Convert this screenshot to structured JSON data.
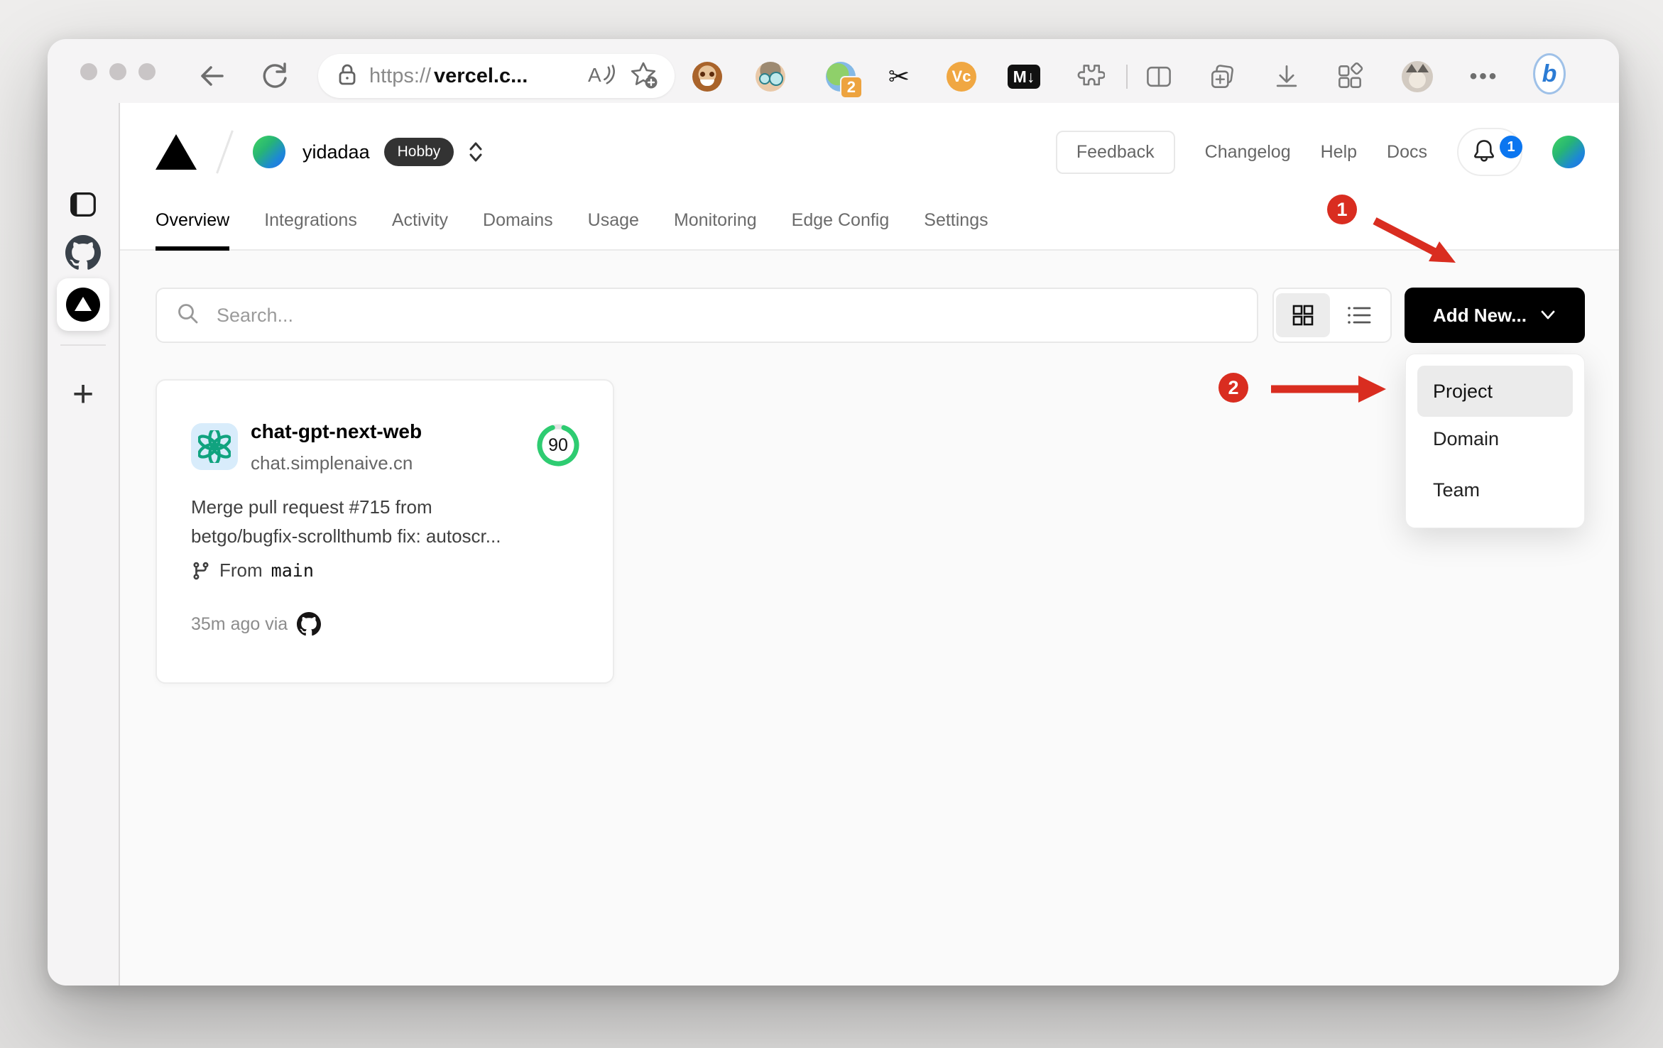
{
  "browser": {
    "address": {
      "scheme": "https://",
      "host": "vercel.c..."
    },
    "extensions": {
      "badge_count": "2",
      "vc_label": "Vc",
      "markdown_label": "M↓",
      "scissors_glyph": "✂"
    },
    "more_label": "•••",
    "bing_label": "b"
  },
  "edge_sidebar": {
    "new_tab_label": "+"
  },
  "vercel": {
    "header": {
      "team_name": "yidadaa",
      "plan_badge": "Hobby",
      "feedback_label": "Feedback",
      "links": {
        "changelog": "Changelog",
        "help": "Help",
        "docs": "Docs"
      },
      "notification_count": "1"
    },
    "tabs": [
      {
        "label": "Overview",
        "active": true
      },
      {
        "label": "Integrations"
      },
      {
        "label": "Activity"
      },
      {
        "label": "Domains"
      },
      {
        "label": "Usage"
      },
      {
        "label": "Monitoring"
      },
      {
        "label": "Edge Config"
      },
      {
        "label": "Settings"
      }
    ],
    "toolbar": {
      "search_placeholder": "Search...",
      "add_new_label": "Add New..."
    },
    "add_new_menu": {
      "items": [
        {
          "label": "Project",
          "highlighted": true
        },
        {
          "label": "Domain"
        },
        {
          "label": "Team"
        }
      ]
    },
    "project_card": {
      "name": "chat-gpt-next-web",
      "domain": "chat.simplenaive.cn",
      "score": "90",
      "commit_line1": "Merge pull request #715 from",
      "commit_line2": "betgo/bugfix-scrollthumb fix: autoscr...",
      "branch_label": "From",
      "branch_name": "main",
      "deploy_meta": "35m ago via"
    }
  },
  "annotations": {
    "step_1": "1",
    "step_2": "2"
  },
  "colors": {
    "annotation_red": "#d92d20",
    "score_green": "#2ecc71",
    "notification_blue": "#0b76f0",
    "openai_teal": "#10a37f"
  }
}
